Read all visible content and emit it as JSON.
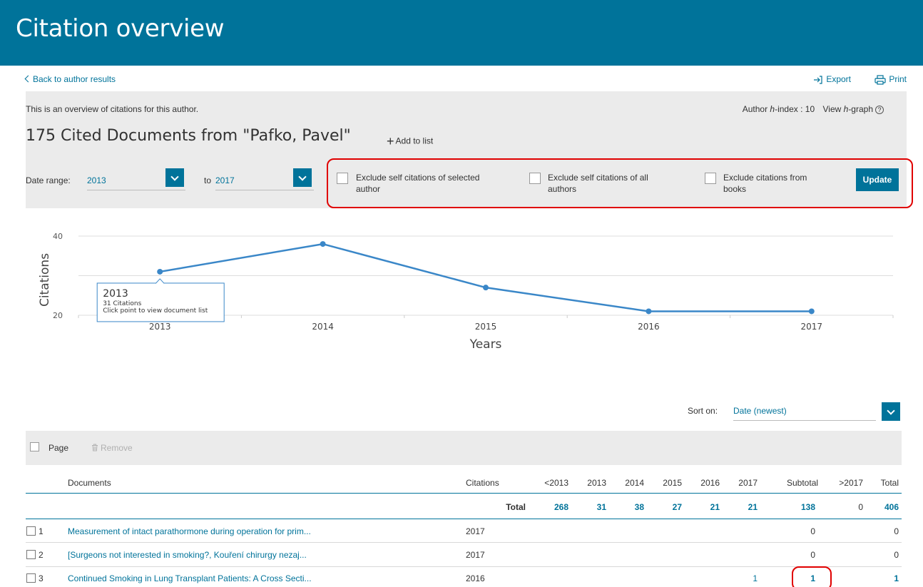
{
  "header": {
    "title": "Citation overview"
  },
  "toplinks": {
    "back": "Back to author results",
    "export": "Export",
    "print": "Print"
  },
  "overview": {
    "intro": "This is an overview of citations for this author.",
    "hindex_prefix": "Author ",
    "hindex_italic": "h",
    "hindex_suffix": "-index : 10",
    "hgraph_prefix": "View ",
    "hgraph_italic": "h",
    "hgraph_suffix": "-graph",
    "title": "175 Cited Documents from \"Pafko, Pavel\"",
    "add_to_list": "Add to list"
  },
  "filters": {
    "date_range_label": "Date range:",
    "from": "2013",
    "to_label": "to",
    "to": "2017",
    "exclude_self_selected_line1": "Exclude self citations of selected",
    "exclude_self_selected_line2": "author",
    "exclude_self_all_line1": "Exclude self citations of all",
    "exclude_self_all_line2": "authors",
    "exclude_books_line1": "Exclude citations from",
    "exclude_books_line2": "books",
    "update": "Update"
  },
  "chart_data": {
    "type": "line",
    "x": [
      "2013",
      "2014",
      "2015",
      "2016",
      "2017"
    ],
    "values": [
      31,
      38,
      27,
      21,
      21
    ],
    "xlabel": "Years",
    "ylabel": "Citations",
    "yticks": [
      20,
      40
    ],
    "ylim": [
      20,
      40
    ],
    "color": "#3a87c8",
    "tooltip": {
      "title": "2013",
      "line1": "31 Citations",
      "line2": "Click point to view document list"
    }
  },
  "sort": {
    "label": "Sort on:",
    "value": "Date (newest)"
  },
  "toolbar": {
    "page": "Page",
    "remove": "Remove"
  },
  "table": {
    "headers": {
      "documents": "Documents",
      "citations": "Citations",
      "lt2013": "<2013",
      "y2013": "2013",
      "y2014": "2014",
      "y2015": "2015",
      "y2016": "2016",
      "y2017": "2017",
      "subtotal": "Subtotal",
      "gt2017": ">2017",
      "total": "Total"
    },
    "total_row": {
      "label": "Total",
      "lt2013": "268",
      "y2013": "31",
      "y2014": "38",
      "y2015": "27",
      "y2016": "21",
      "y2017": "21",
      "subtotal": "138",
      "gt2017": "0",
      "total": "406"
    },
    "rows": [
      {
        "index": "1",
        "title": "Measurement of intact parathormone during operation for prim...",
        "year": "2017",
        "y2017": "",
        "subtotal": "0",
        "total": "0"
      },
      {
        "index": "2",
        "title": "[Surgeons not interested in smoking?, Kouření chirurgy nezaj...",
        "year": "2017",
        "y2017": "",
        "subtotal": "0",
        "total": "0"
      },
      {
        "index": "3",
        "title": "Continued Smoking in Lung Transplant Patients: A Cross Secti...",
        "year": "2016",
        "y2017": "1",
        "subtotal": "1",
        "total": "1"
      }
    ]
  }
}
